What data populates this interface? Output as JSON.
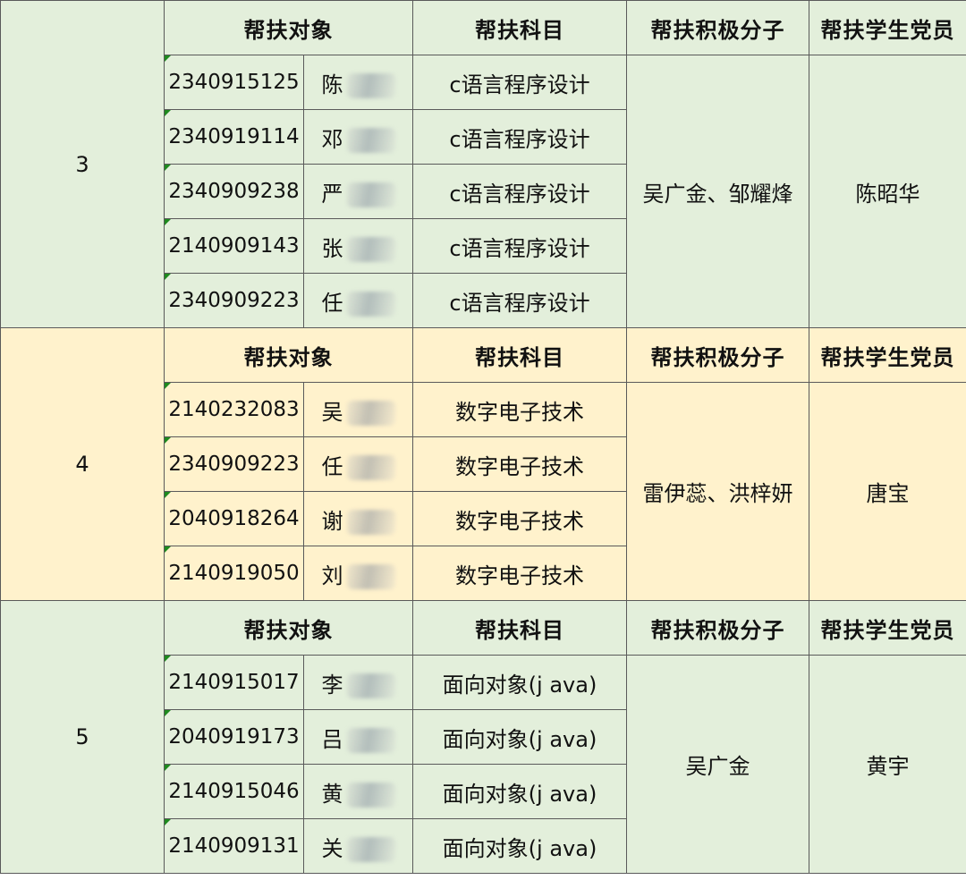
{
  "header": {
    "target": "帮扶对象",
    "subject": "帮扶科目",
    "activists": "帮扶积极分子",
    "party_members": "帮扶学生党员"
  },
  "groups": [
    {
      "no": "3",
      "theme": "green",
      "activists": "吴广金、邹耀烽",
      "party_member": "陈昭华",
      "rows": [
        {
          "id": "2340915125",
          "name": "陈",
          "subject": "c语言程序设计"
        },
        {
          "id": "2340919114",
          "name": "邓",
          "subject": "c语言程序设计"
        },
        {
          "id": "2340909238",
          "name": "严",
          "subject": "c语言程序设计"
        },
        {
          "id": "2140909143",
          "name": "张",
          "subject": "c语言程序设计"
        },
        {
          "id": "2340909223",
          "name": "任",
          "subject": "c语言程序设计"
        }
      ]
    },
    {
      "no": "4",
      "theme": "yellow",
      "activists": "雷伊蕊、洪梓妍",
      "party_member": "唐宝",
      "rows": [
        {
          "id": "2140232083",
          "name": "吴",
          "subject": "数字电子技术"
        },
        {
          "id": "2340909223",
          "name": "任",
          "subject": "数字电子技术"
        },
        {
          "id": "2040918264",
          "name": "谢",
          "subject": "数字电子技术"
        },
        {
          "id": "2140919050",
          "name": "刘",
          "subject": "数字电子技术"
        }
      ]
    },
    {
      "no": "5",
      "theme": "green",
      "activists": "吴广金",
      "party_member": "黄宇",
      "rows": [
        {
          "id": "2140915017",
          "name": "李",
          "subject": "面向对象(j ava)"
        },
        {
          "id": "2040919173",
          "name": "吕",
          "subject": "面向对象(j ava)"
        },
        {
          "id": "2140915046",
          "name": "黄",
          "subject": "面向对象(j ava)"
        },
        {
          "id": "2140909131",
          "name": "关",
          "subject": "面向对象(j ava)"
        }
      ]
    }
  ]
}
